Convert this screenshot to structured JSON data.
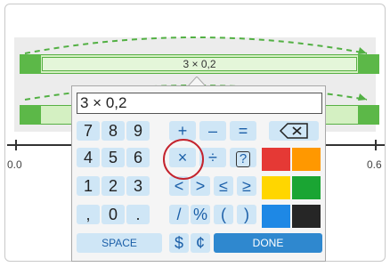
{
  "number_line": {
    "top_bar_label": "3 × 0,2",
    "ticks": [
      "0.0",
      "0.6"
    ]
  },
  "keypad": {
    "display_value": "3 × 0,2",
    "rows": [
      [
        "7",
        "8",
        "9",
        "+",
        "–",
        "="
      ],
      [
        "4",
        "5",
        "6",
        "×",
        "÷",
        "?"
      ],
      [
        "1",
        "2",
        "3",
        "<",
        ">",
        "≤",
        "≥"
      ],
      [
        ",",
        "0",
        ".",
        "/",
        "%",
        "(",
        ")"
      ]
    ],
    "backspace_icon": "backspace-icon",
    "space_label": "SPACE",
    "dollar_label": "$",
    "cent_label": "¢",
    "done_label": "DONE",
    "swatches": [
      "#e53935",
      "#ff9800",
      "#ffd600",
      "#1aa533",
      "#1e88e5",
      "#262626"
    ]
  },
  "highlighted_key": "×"
}
